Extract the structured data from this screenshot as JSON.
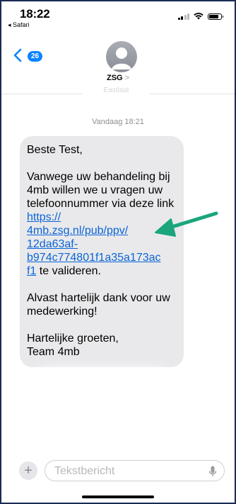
{
  "status_bar": {
    "time": "18:22",
    "back_app": "◂ Safari"
  },
  "header": {
    "unread_count": "26",
    "contact_name": "ZSG",
    "faded_fragment": "Eastlaat"
  },
  "conversation": {
    "timestamp": "Vandaag 18:21",
    "message": {
      "greeting": "Beste Test,",
      "body_before_link": "Vanwege uw behandeling bij 4mb willen we u vragen uw telefoonnummer via deze link ",
      "link_line_1": "https://",
      "link_line_2": "4mb.zsg.nl/pub/ppv/",
      "link_line_3": "12da63af-",
      "link_line_4": "b974c774801f1a35a173ac",
      "link_line_5": "f1",
      "body_after_link": " te valideren.",
      "thanks": "Alvast hartelijk dank voor uw medewerking!",
      "closing_1": "Hartelijke groeten,",
      "closing_2": "Team 4mb"
    }
  },
  "composer": {
    "add_label": "+",
    "placeholder": "Tekstbericht"
  },
  "colors": {
    "accent": "#0a84ff",
    "link": "#0a64d8",
    "bubble": "#e9e9eb",
    "annotation_arrow": "#1aa57c",
    "frame": "#1a2a55"
  },
  "icons": [
    "signal-icon",
    "wifi-icon",
    "battery-icon",
    "back-chevron-icon",
    "contact-avatar-icon",
    "microphone-icon",
    "annotation-arrow"
  ]
}
